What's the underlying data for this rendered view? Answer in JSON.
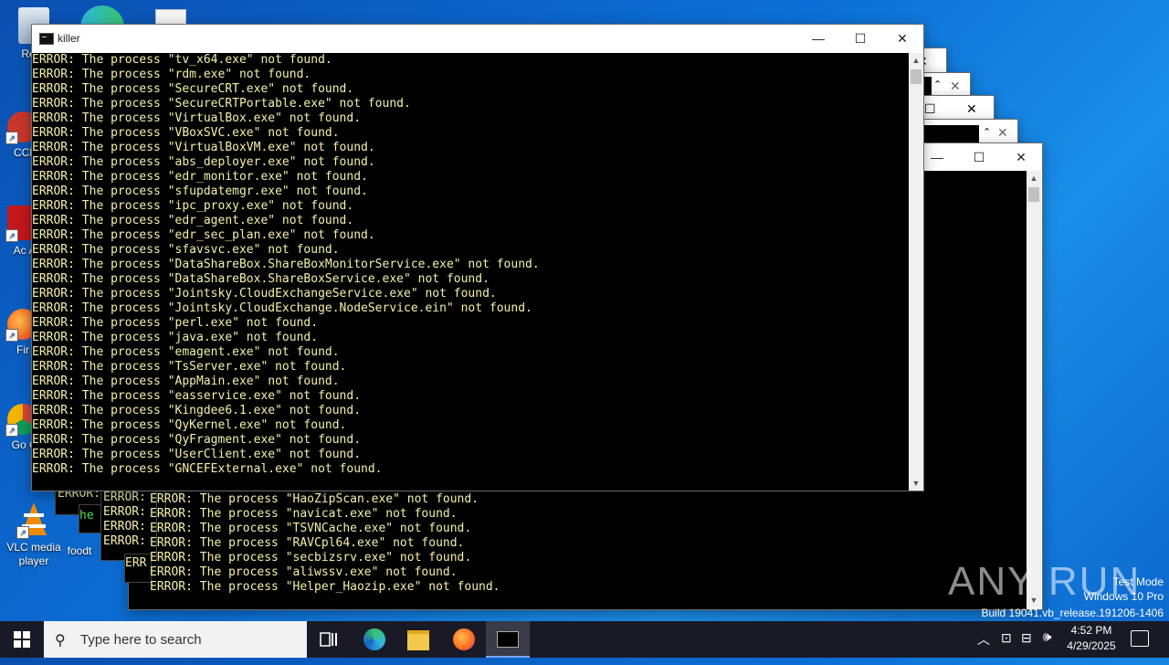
{
  "desktop": {
    "icons": [
      {
        "label": "Recy",
        "icon": "recycle-bin-icon"
      },
      {
        "label": "CCl",
        "icon": "ccleaner-icon"
      },
      {
        "label": "Ac Acr",
        "icon": "acrobat-icon"
      },
      {
        "label": "Fir",
        "icon": "firefox-icon"
      },
      {
        "label": "Go Chr",
        "icon": "chrome-icon"
      },
      {
        "label": "VLC media player",
        "icon": "vlc-icon"
      },
      {
        "label": "foodt",
        "icon": "file-icon"
      }
    ]
  },
  "main_window": {
    "title": "killer",
    "lines": [
      "ERROR: The process \"tv_x64.exe\" not found.",
      "ERROR: The process \"rdm.exe\" not found.",
      "ERROR: The process \"SecureCRT.exe\" not found.",
      "ERROR: The process \"SecureCRTPortable.exe\" not found.",
      "ERROR: The process \"VirtualBox.exe\" not found.",
      "ERROR: The process \"VBoxSVC.exe\" not found.",
      "ERROR: The process \"VirtualBoxVM.exe\" not found.",
      "ERROR: The process \"abs_deployer.exe\" not found.",
      "ERROR: The process \"edr_monitor.exe\" not found.",
      "ERROR: The process \"sfupdatemgr.exe\" not found.",
      "ERROR: The process \"ipc_proxy.exe\" not found.",
      "ERROR: The process \"edr_agent.exe\" not found.",
      "ERROR: The process \"edr_sec_plan.exe\" not found.",
      "ERROR: The process \"sfavsvc.exe\" not found.",
      "ERROR: The process \"DataShareBox.ShareBoxMonitorService.exe\" not found.",
      "ERROR: The process \"DataShareBox.ShareBoxService.exe\" not found.",
      "ERROR: The process \"Jointsky.CloudExchangeService.exe\" not found.",
      "ERROR: The process \"Jointsky.CloudExchange.NodeService.ein\" not found.",
      "ERROR: The process \"perl.exe\" not found.",
      "ERROR: The process \"java.exe\" not found.",
      "ERROR: The process \"emagent.exe\" not found.",
      "ERROR: The process \"TsServer.exe\" not found.",
      "ERROR: The process \"AppMain.exe\" not found.",
      "ERROR: The process \"easservice.exe\" not found.",
      "ERROR: The process \"Kingdee6.1.exe\" not found.",
      "ERROR: The process \"QyKernel.exe\" not found.",
      "ERROR: The process \"QyFragment.exe\" not found.",
      "ERROR: The process \"UserClient.exe\" not found.",
      "ERROR: The process \"GNCEFExternal.exe\" not found."
    ]
  },
  "back_window": {
    "lines": [
      "ERROR: The process \"HaoZipScan.exe\" not found.",
      "ERROR: The process \"navicat.exe\" not found.",
      "ERROR: The process \"TSVNCache.exe\" not found.",
      "ERROR: The process \"RAVCpl64.exe\" not found.",
      "ERROR: The process \"secbizsrv.exe\" not found.",
      "ERROR: The process \"aliwssv.exe\" not found.",
      "ERROR: The process \"Helper_Haozip.exe\" not found."
    ]
  },
  "stacked_fragments": {
    "error_prefix": "ERROR:",
    "green_fragment": "he",
    "err_fragment": "ERR"
  },
  "window_controls": {
    "minimize": "—",
    "maximize": "☐",
    "close": "✕"
  },
  "taskbar": {
    "search_placeholder": "Type here to search",
    "time": "4:52 PM",
    "date": "4/29/2025"
  },
  "watermark": {
    "brand": "ANY RUN",
    "line1": "Test Mode",
    "line2": "Windows 10 Pro",
    "line3": "Build 19041.vb_release.191206-1406"
  },
  "colors": {
    "console_text": "#f4f0a8",
    "console_bg": "#000000",
    "taskbar_bg": "#1a1a26",
    "desktop_bg": "#0c6fd6"
  }
}
